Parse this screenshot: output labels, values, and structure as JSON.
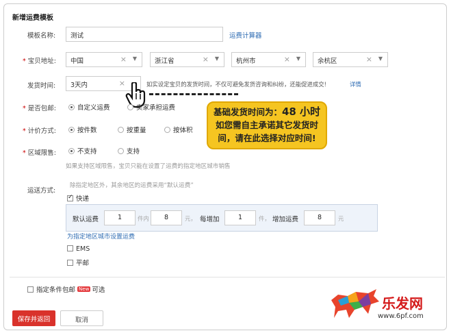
{
  "page_title": "新增运费模板",
  "template_name": {
    "label": "模板名称:",
    "value": "测试",
    "calc_link": "运费计算器"
  },
  "address": {
    "label": "宝贝地址:",
    "country": "中国",
    "province": "浙江省",
    "city": "杭州市",
    "district": "余杭区"
  },
  "ship_time": {
    "label": "发货时间:",
    "value": "3天内",
    "hint": "如实设定宝贝的发货时间，不仅可避免发货咨询和纠纷，还能促进成交!",
    "detail_link": "详情"
  },
  "free_shipping": {
    "label": "是否包邮:",
    "options": [
      "自定义运费",
      "卖家承担运费"
    ]
  },
  "pricing": {
    "label": "计价方式:",
    "options": [
      "按件数",
      "按重量",
      "按体积"
    ]
  },
  "region_limit": {
    "label": "区域限售:",
    "options": [
      "不支持",
      "支持"
    ],
    "hint": "如果支持区域限售，宝贝只能在设置了运费的指定地区城市销售"
  },
  "delivery": {
    "label": "运送方式:",
    "hint": "除指定地区外，其余地区的运费采用“默认运费”",
    "express": "快递",
    "default_fee_label": "默认运费",
    "first_count": "1",
    "unit_item": "件内",
    "first_fee": "8",
    "unit_yuan": "元，",
    "add_label": "每增加",
    "add_count": "1",
    "unit_item2": "件，",
    "add_fee_label": "增加运费",
    "add_fee": "8",
    "unit_yuan2": "元",
    "region_link": "为指定地区城市设置运费",
    "ems": "EMS",
    "post": "平邮"
  },
  "condition": {
    "label": "指定条件包邮",
    "badge": "New",
    "optional": "可选"
  },
  "buttons": {
    "save": "保存并返回",
    "cancel": "取消"
  },
  "callout": {
    "line1_prefix": "基础发货时间为：",
    "line1_value": "48 小时",
    "line2": "如您需自主承诺其它发货时",
    "line3": "间，请在此选择对应时间!"
  },
  "watermark": {
    "text": "乐发网",
    "url": "www.6pf.com"
  }
}
